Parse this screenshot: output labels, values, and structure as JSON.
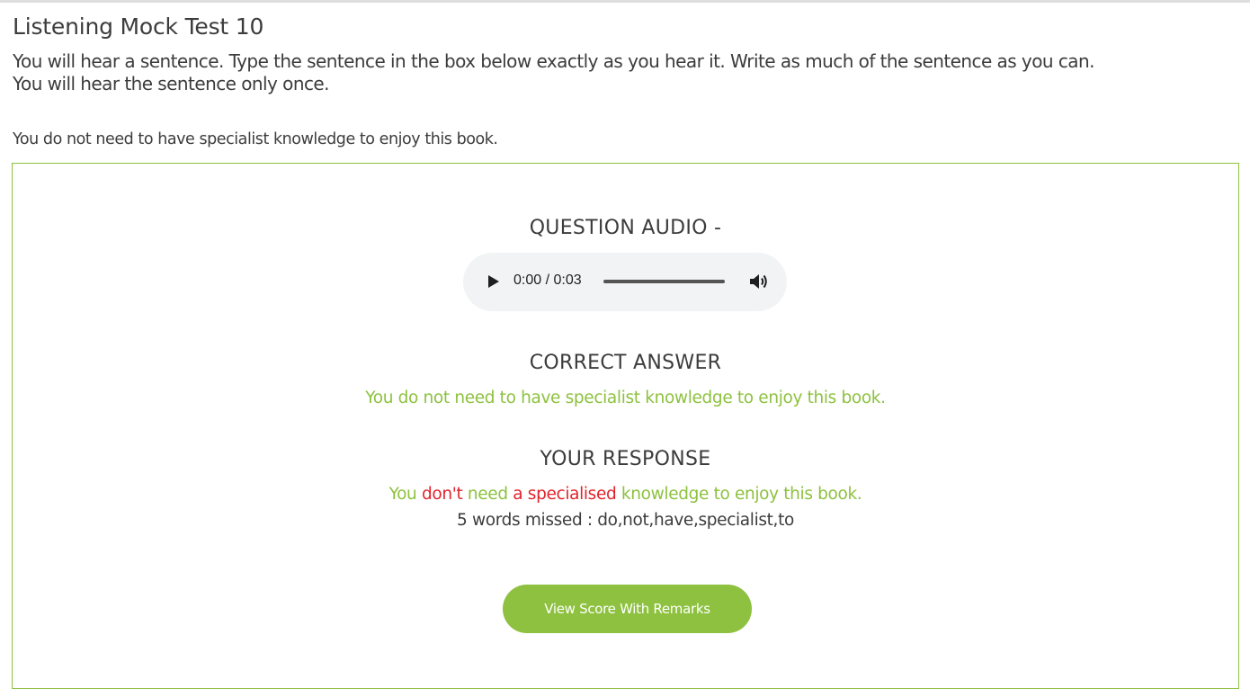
{
  "page": {
    "title": "Listening Mock Test 10",
    "instruction_line1": "You will hear a sentence. Type the sentence in the box below exactly as you hear it. Write as much of the sentence as you can.",
    "instruction_line2": "You will hear the sentence only once.",
    "sentence": "You do not need to have specialist knowledge to enjoy this book."
  },
  "question_audio": {
    "heading": "QUESTION AUDIO -",
    "player": {
      "current_time": "0:00",
      "duration": "0:03",
      "time_display": "0:00 / 0:03",
      "progress": 0,
      "play_icon": "play-icon",
      "volume_icon": "volume-icon"
    }
  },
  "correct_answer": {
    "heading": "CORRECT ANSWER",
    "text": "You do not need to have specialist knowledge to enjoy this book."
  },
  "your_response": {
    "heading": "YOUR RESPONSE",
    "segments": [
      {
        "text": "You ",
        "status": "correct"
      },
      {
        "text": "don't",
        "status": "wrong"
      },
      {
        "text": " need ",
        "status": "correct"
      },
      {
        "text": "a specialised",
        "status": "wrong"
      },
      {
        "text": " knowledge to enjoy this book.",
        "status": "correct"
      }
    ],
    "missed_summary": "5 words missed : do,not,have,specialist,to"
  },
  "actions": {
    "view_score_label": "View Score With Remarks"
  },
  "colors": {
    "accent": "#8dc13f",
    "error": "#e2232c",
    "text": "#3c3c3c"
  }
}
